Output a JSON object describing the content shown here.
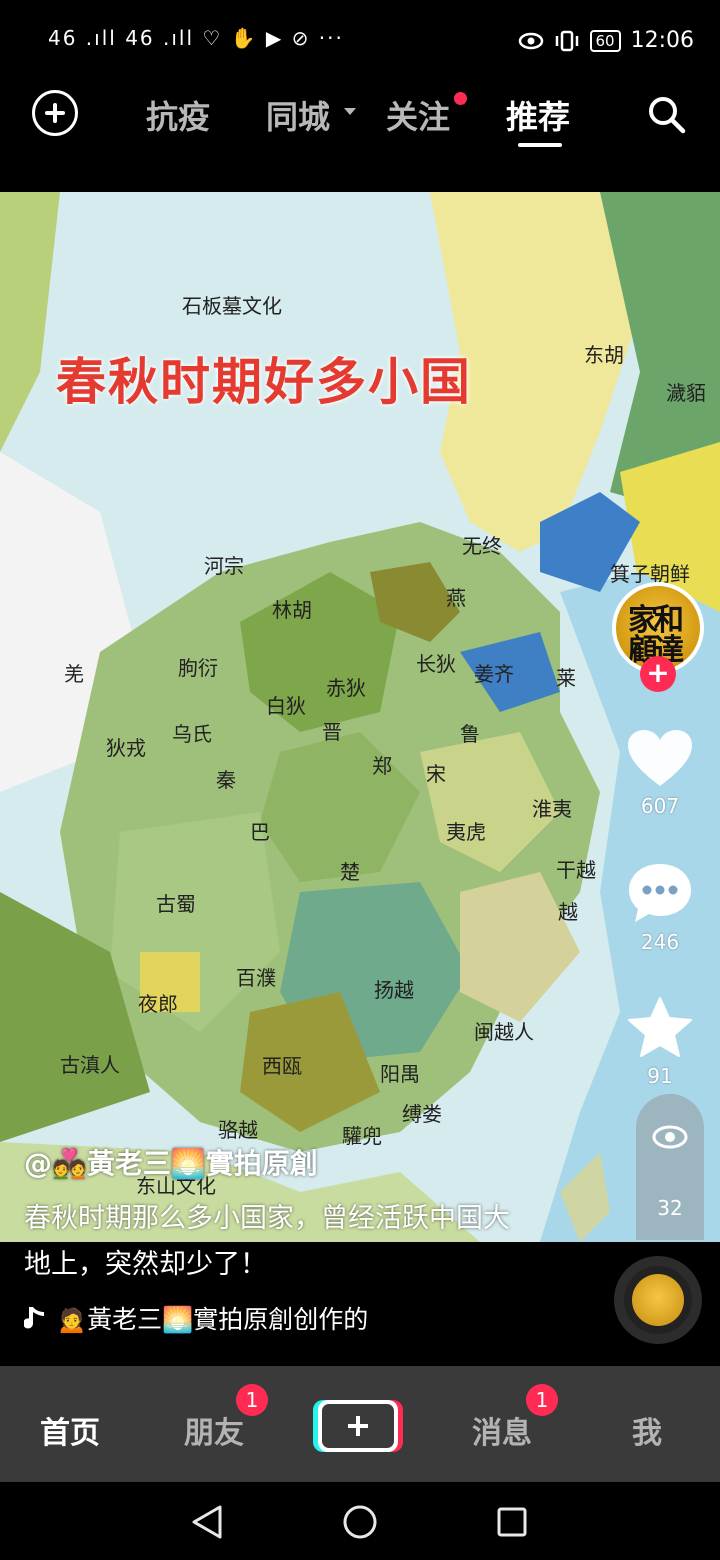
{
  "status_bar": {
    "left": "46 .ıll 46 .ıll ♡ ✋ ▶ ⊘ ···",
    "battery": "60",
    "time": "12:06"
  },
  "top_nav": {
    "tabs": [
      "抗疫",
      "同城",
      "关注",
      "推荐"
    ],
    "active_tab": "推荐"
  },
  "video": {
    "title": "春秋时期好多小国",
    "places": [
      "石板墓文化",
      "东胡",
      "濊貊",
      "无终",
      "箕子朝鲜",
      "河宗",
      "燕",
      "林胡",
      "羌",
      "朐衍",
      "长狄",
      "姜齐",
      "莱",
      "白狄",
      "赤狄",
      "狄戎",
      "乌氏",
      "晋",
      "鲁",
      "郑",
      "宋",
      "秦",
      "淮夷",
      "巴",
      "夷虎",
      "楚",
      "干越",
      "古蜀",
      "越",
      "百濮",
      "扬越",
      "夜郎",
      "闽越人",
      "古滇人",
      "西瓯",
      "阳禺",
      "缚娄",
      "骆越",
      "驩兜",
      "东山文化"
    ]
  },
  "actions": {
    "likes": "607",
    "comments": "246",
    "favorites": "91",
    "views": "32"
  },
  "post": {
    "author": "@💑黃老三🌅實拍原創",
    "caption": "春秋时期那么多小国家，曾经活跃中国大地上，突然却少了！",
    "music": "🙍黃老三🌅實拍原創创作的"
  },
  "bottom_nav": {
    "home": "首页",
    "friends": "朋友",
    "friends_badge": "1",
    "messages": "消息",
    "messages_badge": "1",
    "me": "我"
  },
  "colors": {
    "accent": "#fe2c55",
    "cyan": "#25f4ee",
    "title_red": "#e43a30"
  }
}
